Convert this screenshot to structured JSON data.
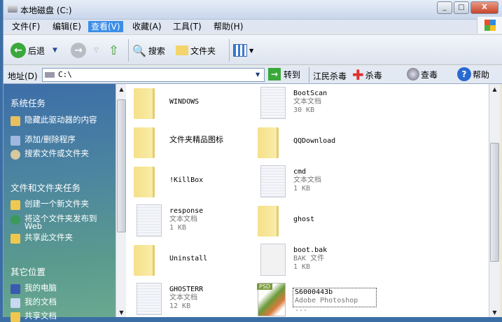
{
  "window": {
    "title": "本地磁盘 (C:)",
    "min": "_",
    "max": "□",
    "close": "X"
  },
  "menu": [
    "文件(F)",
    "编辑(E)",
    "查看(V)",
    "收藏(A)",
    "工具(T)",
    "帮助(H)"
  ],
  "toolbar": {
    "back": "后退",
    "search": "搜索",
    "folders": "文件夹"
  },
  "address": {
    "label": "地址(D)",
    "value": "C:\\",
    "go": "转到",
    "antivirus": "江民杀毒",
    "kill": "杀毒",
    "scan": "查毒",
    "help": "帮助"
  },
  "sidebar": {
    "system_tasks": {
      "title": "系统任务",
      "items": [
        "隐藏此驱动器的内容",
        "添加/删除程序",
        "搜索文件或文件夹"
      ]
    },
    "file_tasks": {
      "title": "文件和文件夹任务",
      "items": [
        "创建一个新文件夹",
        "将这个文件夹发布到 Web",
        "共享此文件夹"
      ]
    },
    "other_places": {
      "title": "其它位置",
      "items": [
        "我的电脑",
        "我的文档",
        "共享文档"
      ]
    }
  },
  "files": [
    {
      "name": "WINDOWS",
      "type": "folder"
    },
    {
      "name": "BootScan",
      "type": "doc",
      "desc": "文本文档",
      "size": "30 KB"
    },
    {
      "name": "文件夹精品图标",
      "type": "folder"
    },
    {
      "name": "QQDownload",
      "type": "folder"
    },
    {
      "name": "!KillBox",
      "type": "folder"
    },
    {
      "name": "cmd",
      "type": "doc",
      "desc": "文本文档",
      "size": "1 KB"
    },
    {
      "name": "response",
      "type": "doc",
      "desc": "文本文档",
      "size": "1 KB"
    },
    {
      "name": "ghost",
      "type": "folder"
    },
    {
      "name": "Uninstall",
      "type": "folder"
    },
    {
      "name": "boot.bak",
      "type": "plain",
      "desc": "BAK 文件",
      "size": "1 KB"
    },
    {
      "name": "GHOSTERR",
      "type": "doc",
      "desc": "文本文档",
      "size": "12 KB"
    },
    {
      "name": "S6000443b",
      "type": "psd",
      "desc": "Adobe Photoshop ...",
      "badge": "PSD"
    }
  ]
}
